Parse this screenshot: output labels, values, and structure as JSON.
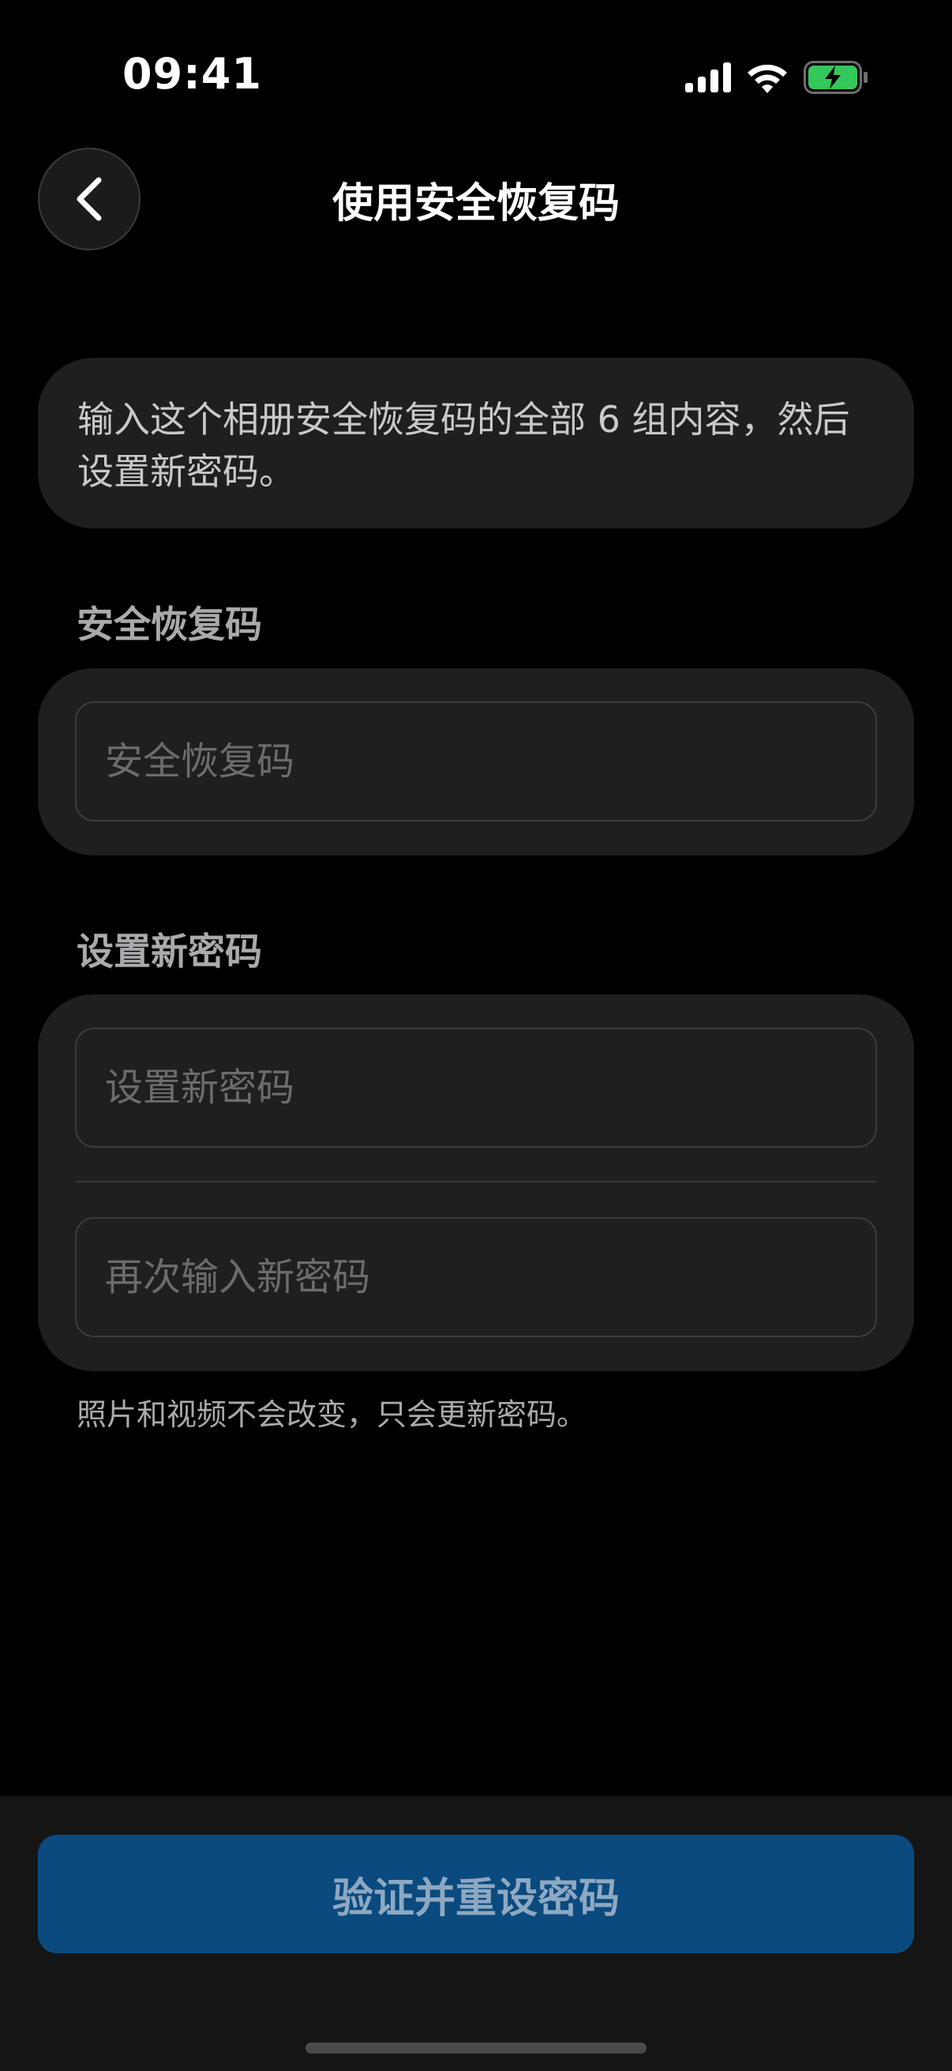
{
  "status_bar": {
    "time": "09:41",
    "icons": [
      "signal-icon",
      "wifi-icon",
      "battery-charging-icon"
    ],
    "battery_color": "#34c759"
  },
  "nav": {
    "back_icon": "chevron-left-icon",
    "title": "使用安全恢复码"
  },
  "info": {
    "text": "输入这个相册安全恢复码的全部 6 组内容，然后设置新密码。"
  },
  "recovery_section": {
    "header": "安全恢复码",
    "field_value": "",
    "field_placeholder": "安全恢复码"
  },
  "password_section": {
    "header": "设置新密码",
    "new_password_value": "",
    "new_password_placeholder": "设置新密码",
    "confirm_password_value": "",
    "confirm_password_placeholder": "再次输入新密码"
  },
  "note": "照片和视频不会改变，只会更新密码。",
  "footer": {
    "button_label": "验证并重设密码",
    "button_color": "#0a4a7e"
  }
}
